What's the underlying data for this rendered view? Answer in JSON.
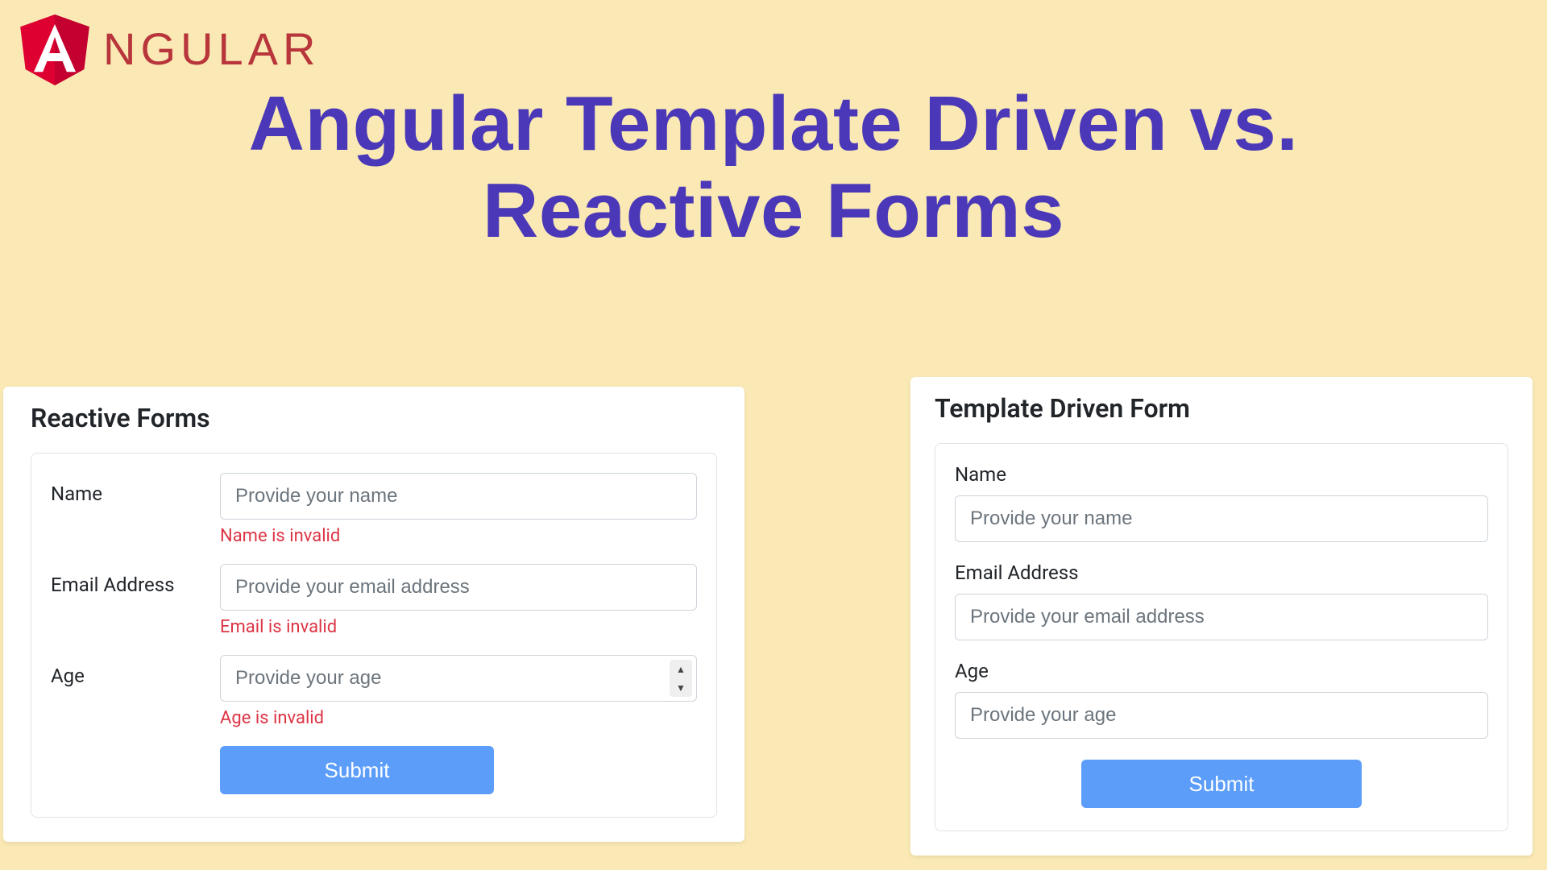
{
  "logo": {
    "word": "NGULAR"
  },
  "headline_line1": "Angular Template Driven vs.",
  "headline_line2": "Reactive Forms",
  "reactive": {
    "title": "Reactive Forms",
    "name_label": "Name",
    "name_placeholder": "Provide your name",
    "name_error": "Name is invalid",
    "email_label": "Email Address",
    "email_placeholder": "Provide your email address",
    "email_error": "Email is invalid",
    "age_label": "Age",
    "age_placeholder": "Provide your age",
    "age_error": "Age is invalid",
    "submit": "Submit"
  },
  "template": {
    "title": "Template Driven Form",
    "name_label": "Name",
    "name_placeholder": "Provide your name",
    "email_label": "Email Address",
    "email_placeholder": "Provide your email address",
    "age_label": "Age",
    "age_placeholder": "Provide your age",
    "submit": "Submit"
  }
}
